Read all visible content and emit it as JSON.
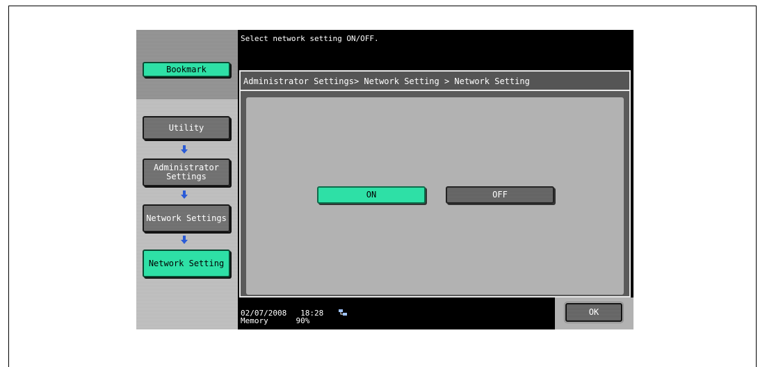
{
  "message": "Select network setting ON/OFF.",
  "breadcrumb": "Administrator Settings> Network Setting > Network Setting",
  "sidebar": {
    "bookmark": "Bookmark",
    "items": [
      "Utility",
      "Administrator Settings",
      "Network Settings",
      "Network Setting"
    ]
  },
  "options": {
    "on": "ON",
    "off": "OFF"
  },
  "ok": "OK",
  "status": {
    "date": "02/07/2008",
    "time": "18:28",
    "memory_label": "Memory",
    "memory_value": "90%"
  },
  "icons": {
    "arrow": "down-arrow-icon",
    "network": "network-status-icon"
  },
  "colors": {
    "accent_green": "#2ee0a6",
    "arrow_blue": "#2a5bd7"
  }
}
